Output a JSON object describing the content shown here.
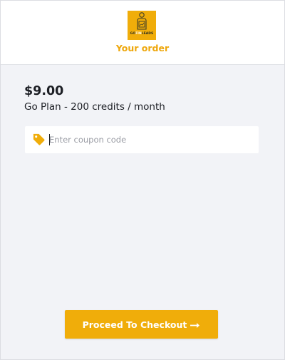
{
  "header": {
    "title": "Your order",
    "logo": {
      "text_part1": "GO",
      "text_part2": "FIN",
      "text_part3": "LEADS",
      "tagline": "",
      "background": "#f0ad0a",
      "icon": "person-with-chart-logo"
    }
  },
  "order": {
    "price": "$9.00",
    "plan": "Go Plan - 200 credits / month"
  },
  "coupon": {
    "placeholder": "Enter coupon code",
    "value": "",
    "icon": "tag-icon"
  },
  "checkout": {
    "label": "Proceed To Checkout",
    "icon": "arrow-right-icon"
  },
  "colors": {
    "accent": "#f0ad0a",
    "title": "#eea70c",
    "panel_bg": "#f2f3f7",
    "text": "#1c1e24"
  }
}
